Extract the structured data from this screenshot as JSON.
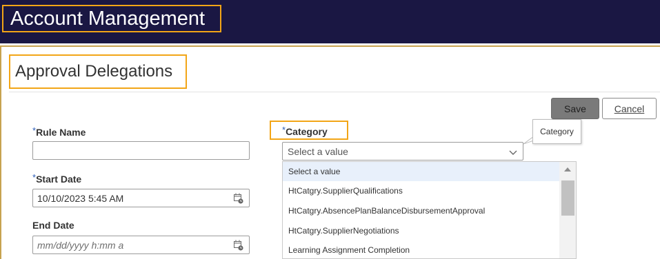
{
  "header": {
    "app_title": "Account Management"
  },
  "page": {
    "title": "Approval Delegations"
  },
  "toolbar": {
    "save_label": "Save",
    "cancel_label": "Cancel"
  },
  "form": {
    "required_marker": "*",
    "rule_name": {
      "label": "Rule Name",
      "value": ""
    },
    "start_date": {
      "label": "Start Date",
      "value": "10/10/2023 5:45 AM"
    },
    "end_date": {
      "label": "End Date",
      "placeholder": "mm/dd/yyyy h:mm a"
    },
    "category": {
      "label": "Category",
      "value": "Select a value",
      "tooltip": "Category",
      "options": [
        "Select a value",
        "HtCatgry.SupplierQualifications",
        "HtCatgry.AbsencePlanBalanceDisbursementApproval",
        "HtCatgry.SupplierNegotiations",
        "Learning Assignment Completion"
      ]
    }
  },
  "icons": {
    "date_picker": "calendar-clock-icon",
    "dropdown": "chevron-down-icon",
    "scroll_up": "triangle-up-icon"
  },
  "colors": {
    "header_bg": "#1a1743",
    "highlight_border": "#f2a516",
    "accent_rule": "#c7a350",
    "required": "#2a5bb7"
  }
}
